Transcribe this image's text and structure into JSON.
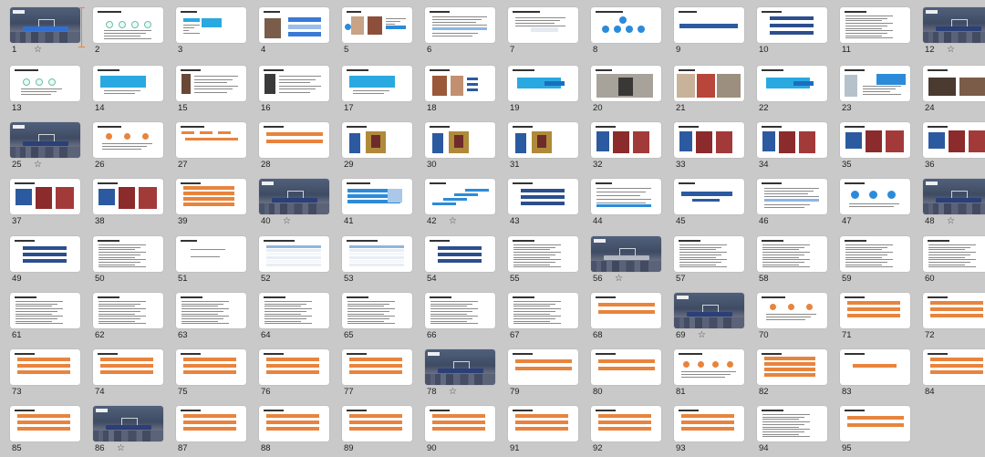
{
  "slides": [
    {
      "n": "1",
      "star": true,
      "kind": "cover",
      "cap": "b"
    },
    {
      "n": "2",
      "kind": "circles4"
    },
    {
      "n": "3",
      "kind": "boxes"
    },
    {
      "n": "4",
      "kind": "arrows"
    },
    {
      "n": "5",
      "kind": "photos"
    },
    {
      "n": "6",
      "kind": "lines"
    },
    {
      "n": "7",
      "kind": "lines2"
    },
    {
      "n": "8",
      "kind": "network"
    },
    {
      "n": "9",
      "kind": "banner"
    },
    {
      "n": "10",
      "kind": "bars_n3"
    },
    {
      "n": "11",
      "kind": "text"
    },
    {
      "n": "12",
      "star": true,
      "kind": "cover",
      "cap": "n"
    },
    {
      "n": "13",
      "kind": "circles3"
    },
    {
      "n": "14",
      "kind": "cyanbox"
    },
    {
      "n": "15",
      "kind": "imgtext"
    },
    {
      "n": "16",
      "kind": "imgtext2"
    },
    {
      "n": "17",
      "kind": "cyanbox"
    },
    {
      "n": "18",
      "kind": "imgtext3"
    },
    {
      "n": "19",
      "kind": "cyanbox2"
    },
    {
      "n": "20",
      "kind": "photo1"
    },
    {
      "n": "21",
      "kind": "photos3"
    },
    {
      "n": "22",
      "kind": "cyanbox2"
    },
    {
      "n": "23",
      "kind": "imgtext4"
    },
    {
      "n": "24",
      "kind": "photos2"
    },
    {
      "n": "25",
      "star": true,
      "kind": "cover",
      "cap": "n"
    },
    {
      "n": "26",
      "kind": "circles3o"
    },
    {
      "n": "27",
      "kind": "flow"
    },
    {
      "n": "28",
      "kind": "obars2"
    },
    {
      "n": "29",
      "kind": "bluecard"
    },
    {
      "n": "30",
      "kind": "bluecard"
    },
    {
      "n": "31",
      "kind": "bluecard"
    },
    {
      "n": "32",
      "kind": "redphotos"
    },
    {
      "n": "33",
      "kind": "redphotos"
    },
    {
      "n": "34",
      "kind": "redphotos"
    },
    {
      "n": "35",
      "kind": "redphotos2"
    },
    {
      "n": "36",
      "kind": "redphotos2"
    },
    {
      "n": "37",
      "kind": "redphotos2"
    },
    {
      "n": "38",
      "kind": "redphotos2"
    },
    {
      "n": "39",
      "kind": "obars4"
    },
    {
      "n": "40",
      "star": true,
      "kind": "cover",
      "cap": "n"
    },
    {
      "n": "41",
      "kind": "bbars"
    },
    {
      "n": "42",
      "star": true,
      "kind": "stairs"
    },
    {
      "n": "43",
      "kind": "bbars3"
    },
    {
      "n": "44",
      "kind": "textblue"
    },
    {
      "n": "45",
      "kind": "arrowsrow"
    },
    {
      "n": "46",
      "kind": "lines"
    },
    {
      "n": "47",
      "kind": "circles3b"
    },
    {
      "n": "48",
      "star": true,
      "kind": "cover",
      "cap": "n"
    },
    {
      "n": "49",
      "kind": "bbars3"
    },
    {
      "n": "50",
      "kind": "text"
    },
    {
      "n": "51",
      "kind": "quote"
    },
    {
      "n": "52",
      "kind": "table"
    },
    {
      "n": "53",
      "kind": "table"
    },
    {
      "n": "54",
      "kind": "bbars3"
    },
    {
      "n": "55",
      "kind": "text"
    },
    {
      "n": "56",
      "star": true,
      "kind": "cover",
      "cap": "w"
    },
    {
      "n": "57",
      "kind": "text"
    },
    {
      "n": "58",
      "kind": "text"
    },
    {
      "n": "59",
      "kind": "text"
    },
    {
      "n": "60",
      "kind": "text"
    },
    {
      "n": "61",
      "kind": "text"
    },
    {
      "n": "62",
      "kind": "text"
    },
    {
      "n": "63",
      "kind": "text"
    },
    {
      "n": "64",
      "kind": "text"
    },
    {
      "n": "65",
      "kind": "text"
    },
    {
      "n": "66",
      "kind": "text"
    },
    {
      "n": "67",
      "kind": "text"
    },
    {
      "n": "68",
      "kind": "obars2"
    },
    {
      "n": "69",
      "star": true,
      "kind": "cover",
      "cap": "n"
    },
    {
      "n": "70",
      "kind": "circles3o"
    },
    {
      "n": "71",
      "kind": "obars3"
    },
    {
      "n": "72",
      "kind": "obars3"
    },
    {
      "n": "73",
      "kind": "obars3"
    },
    {
      "n": "74",
      "kind": "obars3"
    },
    {
      "n": "75",
      "kind": "obars3"
    },
    {
      "n": "76",
      "kind": "obars3"
    },
    {
      "n": "77",
      "kind": "obars3"
    },
    {
      "n": "78",
      "star": true,
      "kind": "cover",
      "cap": "n"
    },
    {
      "n": "79",
      "kind": "obars2"
    },
    {
      "n": "80",
      "kind": "obars2"
    },
    {
      "n": "81",
      "kind": "circles4o"
    },
    {
      "n": "82",
      "kind": "obars4"
    },
    {
      "n": "83",
      "kind": "obar1"
    },
    {
      "n": "84",
      "kind": "obars3"
    },
    {
      "n": "85",
      "kind": "obars3"
    },
    {
      "n": "86",
      "star": true,
      "kind": "cover",
      "cap": "n"
    },
    {
      "n": "87",
      "kind": "obars3"
    },
    {
      "n": "88",
      "kind": "obars3"
    },
    {
      "n": "89",
      "kind": "obars3"
    },
    {
      "n": "90",
      "kind": "obars3"
    },
    {
      "n": "91",
      "kind": "obars3"
    },
    {
      "n": "92",
      "kind": "obars3"
    },
    {
      "n": "93",
      "kind": "obars3"
    },
    {
      "n": "94",
      "kind": "text"
    },
    {
      "n": "95",
      "kind": "obars2"
    }
  ],
  "colors": {
    "background": "#c9c9c9",
    "accent_orange": "#e8843d",
    "accent_blue": "#2c8bd9",
    "navy": "#2b4f8e",
    "star": "star-icon"
  }
}
